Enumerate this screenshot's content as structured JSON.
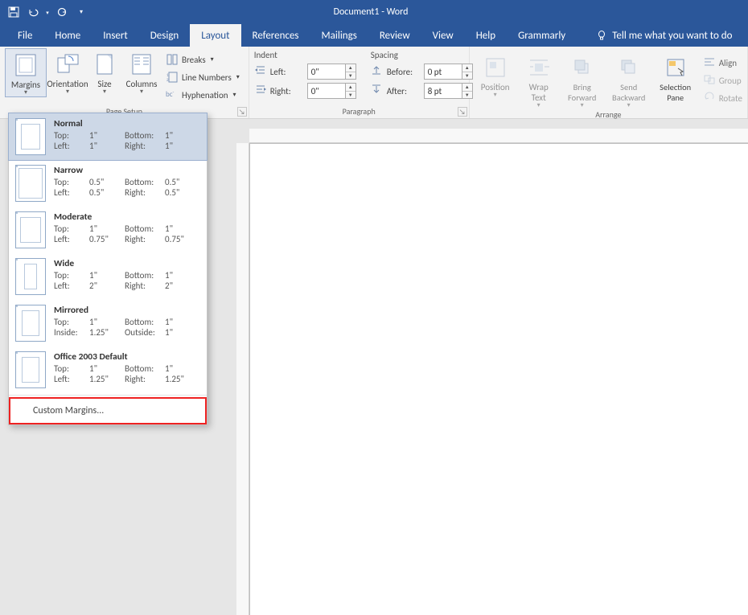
{
  "title": "Document1 - Word",
  "tabs": [
    "File",
    "Home",
    "Insert",
    "Design",
    "Layout",
    "References",
    "Mailings",
    "Review",
    "View",
    "Help",
    "Grammarly"
  ],
  "active_tab": "Layout",
  "tellme": "Tell me what you want to do",
  "page_setup": {
    "margins_label": "Margins",
    "orientation_label": "Orientation",
    "size_label": "Size",
    "columns_label": "Columns",
    "breaks_label": "Breaks",
    "line_numbers_label": "Line Numbers",
    "hyphenation_label": "Hyphenation",
    "group_label": "Page Setup"
  },
  "paragraph": {
    "group_label": "Paragraph",
    "indent_head": "Indent",
    "spacing_head": "Spacing",
    "left_label": "Left:",
    "right_label": "Right:",
    "before_label": "Before:",
    "after_label": "After:",
    "left_val": "0\"",
    "right_val": "0\"",
    "before_val": "0 pt",
    "after_val": "8 pt"
  },
  "arrange": {
    "group_label": "Arrange",
    "position_label": "Position",
    "wrap_label": "Wrap Text",
    "bring_label": "Bring Forward",
    "send_label": "Send Backward",
    "selection_label": "Selection Pane",
    "align_label": "Align",
    "group_btn_label": "Group",
    "rotate_label": "Rotate"
  },
  "margins_menu": {
    "custom_label": "Custom Margins...",
    "options": [
      {
        "name": "Normal",
        "top": "1\"",
        "left": "1\"",
        "bottom": "1\"",
        "right": "1\"",
        "leftlab": "Left:",
        "rightlab": "Right:"
      },
      {
        "name": "Narrow",
        "top": "0.5\"",
        "left": "0.5\"",
        "bottom": "0.5\"",
        "right": "0.5\"",
        "leftlab": "Left:",
        "rightlab": "Right:"
      },
      {
        "name": "Moderate",
        "top": "1\"",
        "left": "0.75\"",
        "bottom": "1\"",
        "right": "0.75\"",
        "leftlab": "Left:",
        "rightlab": "Right:"
      },
      {
        "name": "Wide",
        "top": "1\"",
        "left": "2\"",
        "bottom": "1\"",
        "right": "2\"",
        "leftlab": "Left:",
        "rightlab": "Right:"
      },
      {
        "name": "Mirrored",
        "top": "1\"",
        "left": "1.25\"",
        "bottom": "1\"",
        "right": "1\"",
        "leftlab": "Inside:",
        "rightlab": "Outside:"
      },
      {
        "name": "Office 2003 Default",
        "top": "1\"",
        "left": "1.25\"",
        "bottom": "1\"",
        "right": "1.25\"",
        "leftlab": "Left:",
        "rightlab": "Right:"
      }
    ]
  }
}
